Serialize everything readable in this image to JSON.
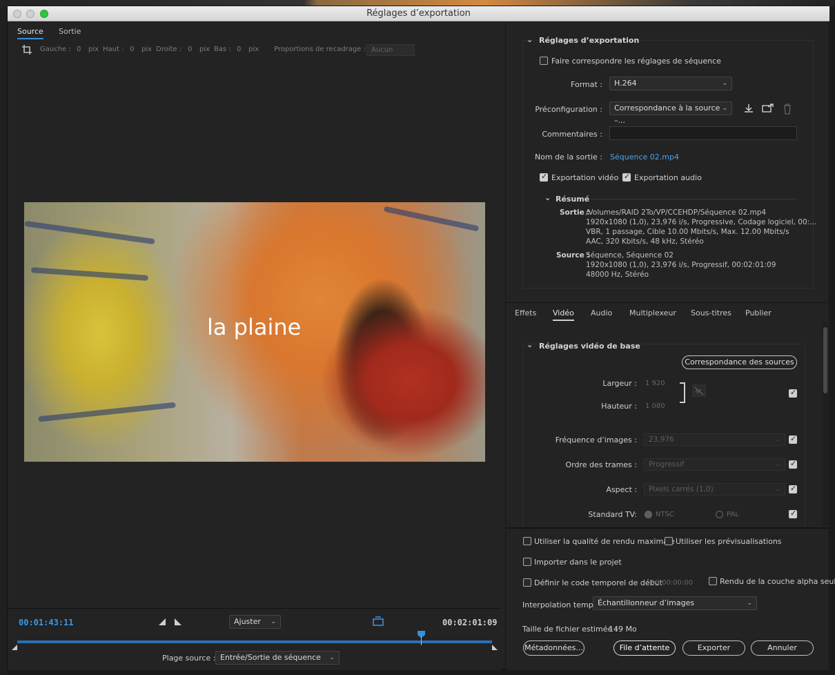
{
  "window": {
    "title": "Réglages d’exportation"
  },
  "left": {
    "tabs": [
      "Source",
      "Sortie"
    ],
    "crop": {
      "left_label": "Gauche :",
      "left_val": "0",
      "top_label": "Haut :",
      "top_val": "0",
      "right_label": "Droite :",
      "right_val": "0",
      "bottom_label": "Bas :",
      "bottom_val": "0",
      "unit": "pix",
      "ratio_label": "Proportions de recadrage :",
      "ratio_value": "Aucun"
    },
    "preview_text": "la plaine",
    "timecode_in": "00:01:43:11",
    "timecode_out": "00:02:01:09",
    "fit_value": "Ajuster",
    "source_range_label": "Plage source :",
    "source_range_value": "Entrée/Sortie de séquence"
  },
  "export": {
    "section_title": "Réglages d’exportation",
    "match_sequence": "Faire correspondre les réglages de séquence",
    "format_label": "Format :",
    "format_value": "H.264",
    "preset_label": "Préconfiguration :",
    "preset_value": "Correspondance à la source –...",
    "comments_label": "Commentaires :",
    "output_name_label": "Nom de la sortie :",
    "output_name_value": "Séquence 02.mp4",
    "export_video": "Exportation vidéo",
    "export_audio": "Exportation audio",
    "summary_title": "Résumé",
    "summary_output_label": "Sortie :",
    "summary_output_lines": [
      "/Volumes/RAID 2To/VP/CCEHDP/Séquence 02.mp4",
      "1920x1080 (1,0), 23,976 i/s, Progressive, Codage logiciel, 00:...",
      "VBR, 1 passage, Cible 10.00  Mbits/s, Max. 12.00  Mbits/s",
      "AAC, 320  Kbits/s, 48  kHz, Stéréo"
    ],
    "summary_source_label": "Source :",
    "summary_source_lines": [
      "Séquence, Séquence 02",
      "1920x1080 (1,0), 23,976  i/s, Progressif, 00:02:01:09",
      "48000 Hz, Stéréo"
    ]
  },
  "tabs_right": [
    "Effets",
    "Vidéo",
    "Audio",
    "Multiplexeur",
    "Sous-titres",
    "Publier"
  ],
  "video": {
    "section_title": "Réglages vidéo de base",
    "match_source_button": "Correspondance des sources",
    "width_label": "Largeur :",
    "width_value": "1 920",
    "height_label": "Hauteur :",
    "height_value": "1 080",
    "fps_label": "Fréquence d’images :",
    "fps_value": "23,976",
    "field_order_label": "Ordre des trames :",
    "field_order_value": "Progressif",
    "aspect_label": "Aspect :",
    "aspect_value": "Pixels carrés (1,0)",
    "tv_standard_label": "Standard TV:",
    "ntsc": "NTSC",
    "pal": "PAL"
  },
  "bottom": {
    "max_render_quality": "Utiliser la qualité de rendu maximale",
    "use_previews": "Utiliser les prévisualisations",
    "import_project": "Importer dans le projet",
    "set_start_timecode": "Définir le code temporel de début",
    "start_timecode_value": "00:00:00:00",
    "alpha_only": "Rendu de la couche alpha seule",
    "time_interp_label": "Interpolation temporelle :",
    "time_interp_value": "Échantillonneur d’images",
    "file_size_label": "Taille de fichier estimée :",
    "file_size_value": "149 Mo",
    "metadata_button": "Métadonnées...",
    "queue_button": "File d’attente",
    "export_button": "Exporter",
    "cancel_button": "Annuler"
  },
  "colors": {
    "accent": "#3a98e8",
    "link": "#4aa3f0"
  }
}
